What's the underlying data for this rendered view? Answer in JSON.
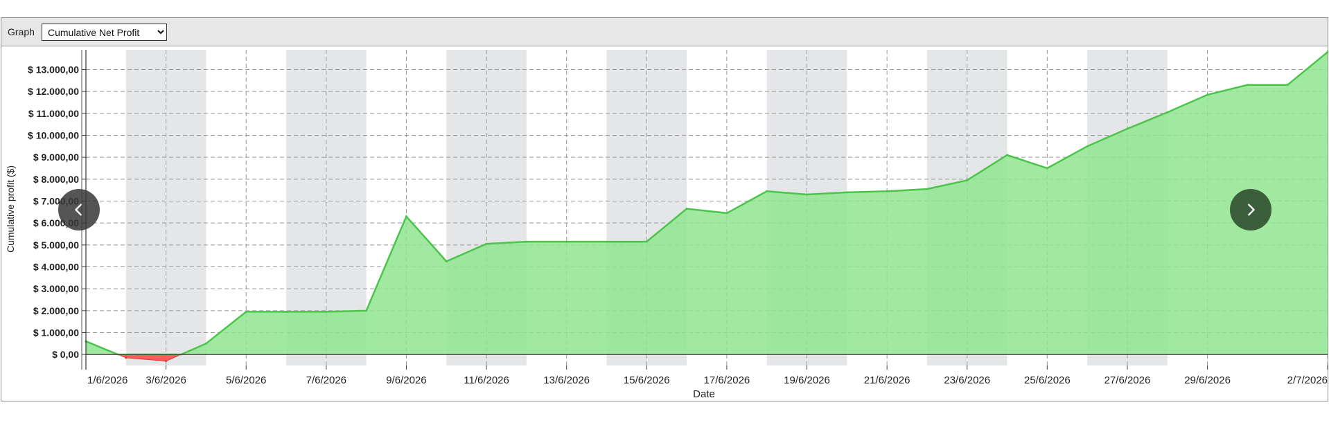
{
  "toolbar": {
    "graph_label": "Graph",
    "graph_options": [
      "Cumulative Net Profit"
    ],
    "graph_selected": "Cumulative Net Profit"
  },
  "nav": {
    "prev_icon": "chevron-left-icon",
    "next_icon": "chevron-right-icon"
  },
  "colors": {
    "positive_fill": "#90e590",
    "positive_line": "#4cc44c",
    "negative_fill": "#ff5a5a",
    "weekend_band": "#e5e6e8",
    "grid": "#999999"
  },
  "chart_data": {
    "type": "area",
    "title": "",
    "xlabel": "Date",
    "ylabel": "Cumulative profit ($)",
    "x_tick_labels": [
      "1/6/2026",
      "3/6/2026",
      "5/6/2026",
      "7/6/2026",
      "9/6/2026",
      "11/6/2026",
      "13/6/2026",
      "15/6/2026",
      "17/6/2026",
      "19/6/2026",
      "21/6/2026",
      "23/6/2026",
      "25/6/2026",
      "27/6/2026",
      "29/6/2026",
      "2/7/2026"
    ],
    "y_tick_labels": [
      "$ 0,00",
      "$ 1.000,00",
      "$ 2.000,00",
      "$ 3.000,00",
      "$ 4.000,00",
      "$ 5.000,00",
      "$ 6.000,00",
      "$ 7.000,00",
      "$ 8.000,00",
      "$ 9.000,00",
      "$ 10.000,00",
      "$ 11.000,00",
      "$ 12.000,00",
      "$ 13.000,00"
    ],
    "ylim": [
      -500,
      13900
    ],
    "grid": true,
    "shaded_bands": [
      [
        "2/6/2026",
        "4/6/2026"
      ],
      [
        "6/6/2026",
        "8/6/2026"
      ],
      [
        "10/6/2026",
        "12/6/2026"
      ],
      [
        "14/6/2026",
        "16/6/2026"
      ],
      [
        "18/6/2026",
        "20/6/2026"
      ],
      [
        "22/6/2026",
        "24/6/2026"
      ],
      [
        "26/6/2026",
        "28/6/2026"
      ]
    ],
    "series": [
      {
        "x": [
          "1/6/2026",
          "2/6/2026",
          "3/6/2026",
          "4/6/2026",
          "5/6/2026",
          "6/6/2026",
          "7/6/2026",
          "8/6/2026",
          "9/6/2026",
          "10/6/2026",
          "11/6/2026",
          "12/6/2026",
          "13/6/2026",
          "14/6/2026",
          "15/6/2026",
          "16/6/2026",
          "17/6/2026",
          "18/6/2026",
          "19/6/2026",
          "20/6/2026",
          "21/6/2026",
          "22/6/2026",
          "23/6/2026",
          "24/6/2026",
          "25/6/2026",
          "26/6/2026",
          "27/6/2026",
          "28/6/2026",
          "29/6/2026",
          "30/6/2026",
          "1/7/2026",
          "2/7/2026"
        ],
        "values": [
          600,
          -150,
          -300,
          500,
          1950,
          1950,
          1950,
          2000,
          6300,
          4250,
          5050,
          5150,
          5150,
          5150,
          5150,
          6650,
          6450,
          7450,
          7300,
          7400,
          7450,
          7550,
          7950,
          9100,
          8500,
          9500,
          10300,
          11050,
          11850,
          12300,
          12300,
          13800
        ]
      }
    ]
  }
}
